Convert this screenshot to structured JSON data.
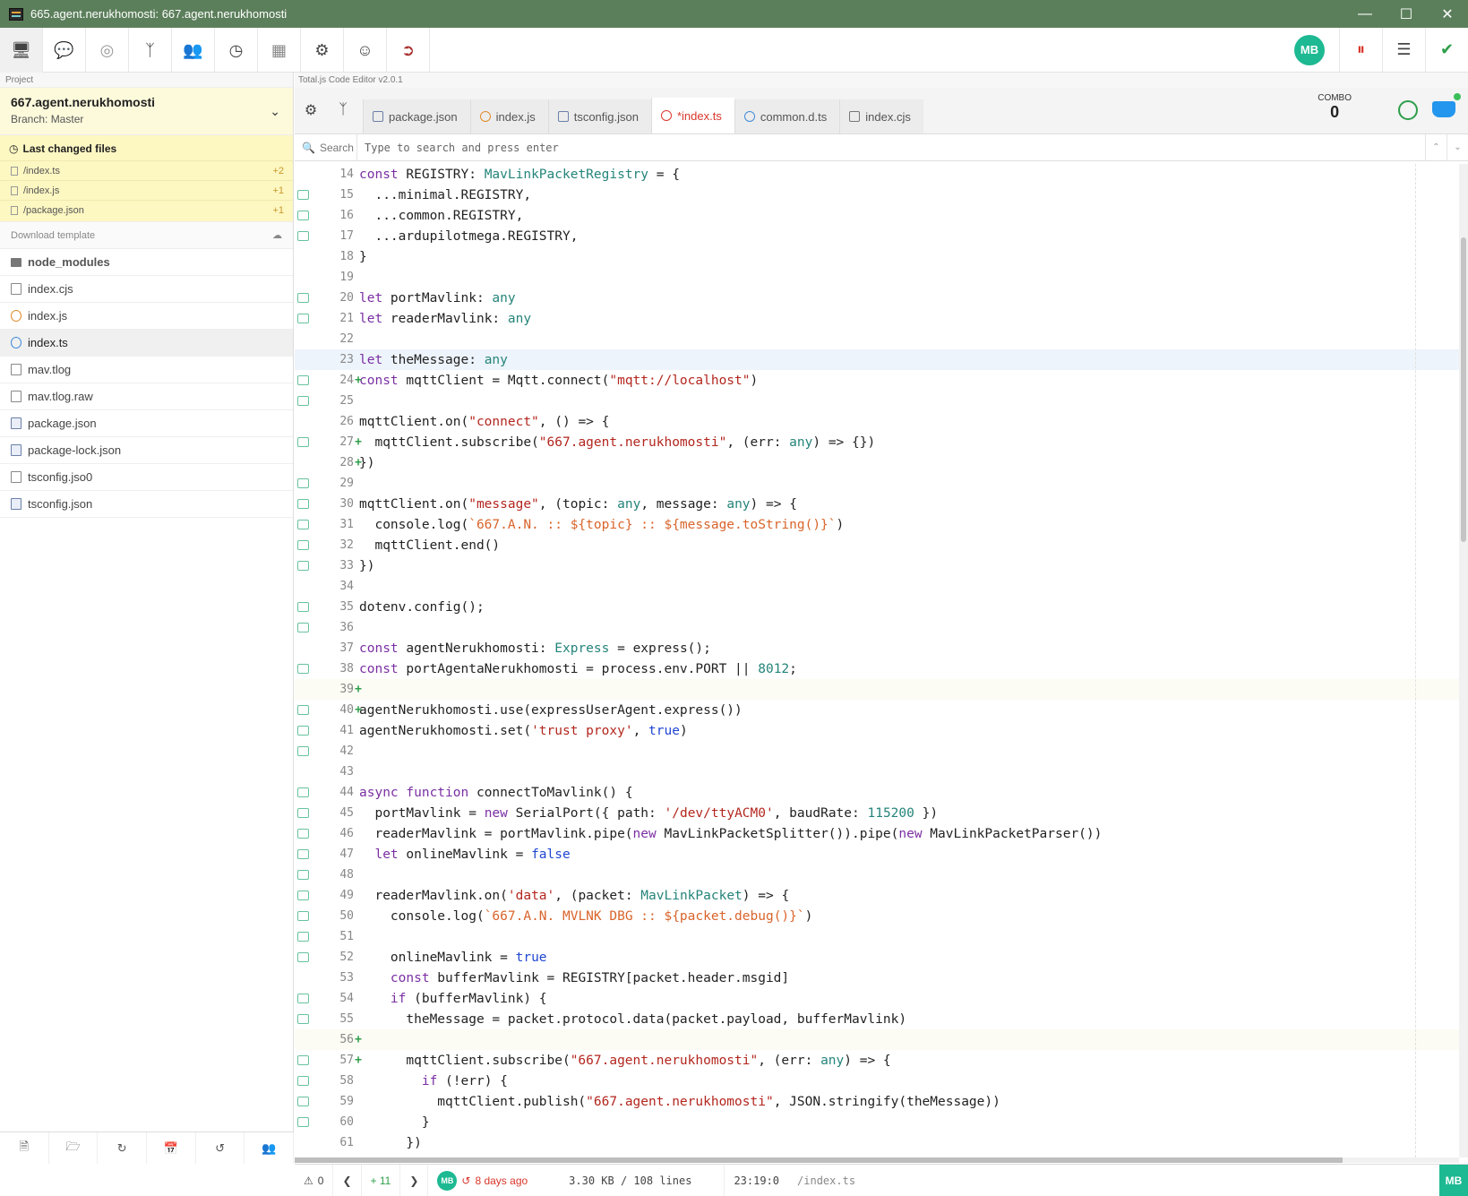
{
  "window": {
    "title": "665.agent.nerukhomosti: 667.agent.nerukhomosti"
  },
  "toolbar": {
    "icons": [
      "monitor-icon",
      "chat-icon",
      "lifebuoy-icon",
      "branch-icon",
      "users-icon",
      "clock-icon",
      "apps-icon",
      "gear-icon",
      "account-icon",
      "logout-icon"
    ],
    "user_initials": "MB"
  },
  "sidebar": {
    "label": "Project",
    "project_name": "667.agent.nerukhomosti",
    "branch": "Branch: Master",
    "changed_title": "Last changed files",
    "changed": [
      {
        "path": "/index.ts",
        "count": "+2"
      },
      {
        "path": "/index.js",
        "count": "+1"
      },
      {
        "path": "/package.json",
        "count": "+1"
      }
    ],
    "download_template": "Download template",
    "files": [
      {
        "name": "node_modules",
        "type": "folder"
      },
      {
        "name": "index.cjs",
        "type": "file"
      },
      {
        "name": "index.js",
        "type": "js"
      },
      {
        "name": "index.ts",
        "type": "ts"
      },
      {
        "name": "mav.tlog",
        "type": "file"
      },
      {
        "name": "mav.tlog.raw",
        "type": "file"
      },
      {
        "name": "package.json",
        "type": "json"
      },
      {
        "name": "package-lock.json",
        "type": "json"
      },
      {
        "name": "tsconfig.jso0",
        "type": "file"
      },
      {
        "name": "tsconfig.json",
        "type": "json"
      }
    ]
  },
  "editor": {
    "version": "Total.js Code Editor v2.0.1",
    "tabs": [
      {
        "label": "package.json",
        "type": "json"
      },
      {
        "label": "index.js",
        "type": "js"
      },
      {
        "label": "tsconfig.json",
        "type": "json"
      },
      {
        "label": "*index.ts",
        "type": "ts",
        "active": true
      },
      {
        "label": "common.d.ts",
        "type": "dts"
      },
      {
        "label": "index.cjs",
        "type": "file"
      }
    ],
    "combo_label": "COMBO",
    "combo_value": "0",
    "search_label": "Search",
    "search_placeholder": "Type to search and press enter"
  },
  "code_lines": [
    {
      "n": "14",
      "t": "const REGISTRY: MavLinkPacketRegistry = {"
    },
    {
      "n": "15",
      "t": "  ...minimal.REGISTRY,"
    },
    {
      "n": "16",
      "t": "  ...common.REGISTRY,"
    },
    {
      "n": "17",
      "t": "  ...ardupilotmega.REGISTRY,"
    },
    {
      "n": "18",
      "t": "}"
    },
    {
      "n": "19",
      "t": ""
    },
    {
      "n": "20",
      "t": "let portMavlink: any"
    },
    {
      "n": "21",
      "t": "let readerMavlink: any"
    },
    {
      "n": "22",
      "t": ""
    },
    {
      "n": "23",
      "t": "let theMessage: any"
    },
    {
      "n": "24",
      "t": "const mqttClient = Mqtt.connect(\"mqtt://localhost\")"
    },
    {
      "n": "25",
      "t": ""
    },
    {
      "n": "26",
      "t": "mqttClient.on(\"connect\", () => {"
    },
    {
      "n": "27",
      "t": "  mqttClient.subscribe(\"667.agent.nerukhomosti\", (err: any) => {})"
    },
    {
      "n": "28",
      "t": "})"
    },
    {
      "n": "29",
      "t": ""
    },
    {
      "n": "30",
      "t": "mqttClient.on(\"message\", (topic: any, message: any) => {"
    },
    {
      "n": "31",
      "t": "  console.log(`667.A.N. :: ${topic} :: ${message.toString()}`)"
    },
    {
      "n": "32",
      "t": "  mqttClient.end()"
    },
    {
      "n": "33",
      "t": "})"
    },
    {
      "n": "34",
      "t": ""
    },
    {
      "n": "35",
      "t": "dotenv.config();"
    },
    {
      "n": "36",
      "t": ""
    },
    {
      "n": "37",
      "t": "const agentNerukhomosti: Express = express();"
    },
    {
      "n": "38",
      "t": "const portAgentaNerukhomosti = process.env.PORT || 8012;"
    },
    {
      "n": "39",
      "t": ""
    },
    {
      "n": "40",
      "t": "agentNerukhomosti.use(expressUserAgent.express())"
    },
    {
      "n": "41",
      "t": "agentNerukhomosti.set('trust proxy', true)"
    },
    {
      "n": "42",
      "t": ""
    },
    {
      "n": "43",
      "t": ""
    },
    {
      "n": "44",
      "t": "async function connectToMavlink() {"
    },
    {
      "n": "45",
      "t": "  portMavlink = new SerialPort({ path: '/dev/ttyACM0', baudRate: 115200 })"
    },
    {
      "n": "46",
      "t": "  readerMavlink = portMavlink.pipe(new MavLinkPacketSplitter()).pipe(new MavLinkPacketParser())"
    },
    {
      "n": "47",
      "t": "  let onlineMavlink = false"
    },
    {
      "n": "48",
      "t": ""
    },
    {
      "n": "49",
      "t": "  readerMavlink.on('data', (packet: MavLinkPacket) => {"
    },
    {
      "n": "50",
      "t": "    console.log(`667.A.N. MVLNK DBG :: ${packet.debug()}`)"
    },
    {
      "n": "51",
      "t": ""
    },
    {
      "n": "52",
      "t": "    onlineMavlink = true"
    },
    {
      "n": "53",
      "t": "    const bufferMavlink = REGISTRY[packet.header.msgid]"
    },
    {
      "n": "54",
      "t": "    if (bufferMavlink) {"
    },
    {
      "n": "55",
      "t": "      theMessage = packet.protocol.data(packet.payload, bufferMavlink)"
    },
    {
      "n": "56",
      "t": ""
    },
    {
      "n": "57",
      "t": "      mqttClient.subscribe(\"667.agent.nerukhomosti\", (err: any) => {"
    },
    {
      "n": "58",
      "t": "        if (!err) {"
    },
    {
      "n": "59",
      "t": "          mqttClient.publish(\"667.agent.nerukhomosti\", JSON.stringify(theMessage))"
    },
    {
      "n": "60",
      "t": "        }"
    },
    {
      "n": "61",
      "t": "      })"
    }
  ],
  "line_marks": {
    "mb": [
      "15",
      "16",
      "17",
      "20",
      "21",
      "24",
      "25",
      "27",
      "29",
      "30",
      "31",
      "32",
      "33",
      "35",
      "36",
      "38",
      "40",
      "41",
      "42",
      "44",
      "45",
      "46",
      "47",
      "48",
      "49",
      "50",
      "51",
      "52",
      "54",
      "55",
      "57",
      "58",
      "59",
      "60"
    ],
    "plus": [
      "24",
      "27",
      "28",
      "39",
      "40",
      "56",
      "57"
    ],
    "highlight": "23"
  },
  "status": {
    "warnings": "0",
    "changes": "+ 11",
    "user": "MB",
    "ago": "8 days ago",
    "size": "3.30 KB / 108 lines",
    "position": "23:19:0",
    "path": "/index.ts",
    "end_badge": "MB"
  }
}
